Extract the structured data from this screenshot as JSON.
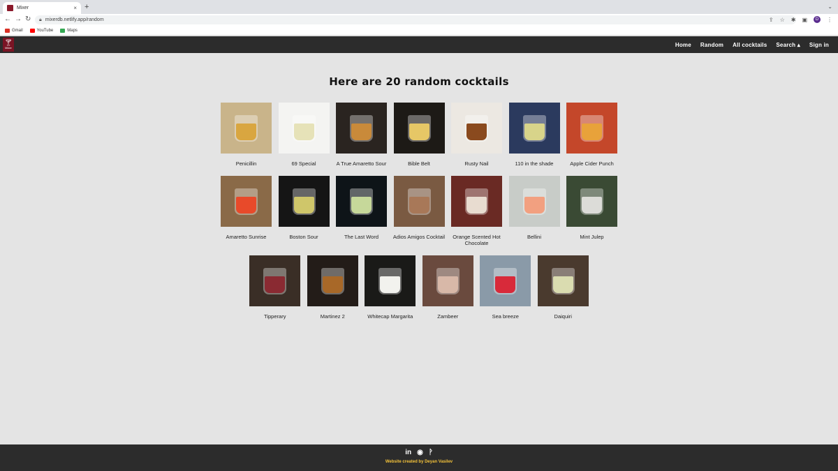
{
  "browser": {
    "tab_title": "Mixer",
    "tab_close": "×",
    "new_tab": "+",
    "url": "mixerdb.netlify.app/random",
    "avatar_letter": "D",
    "bookmarks": [
      {
        "label": "Gmail",
        "color": "#d93025"
      },
      {
        "label": "YouTube",
        "color": "#ff0000"
      },
      {
        "label": "Maps",
        "color": "#34a853"
      }
    ]
  },
  "nav": {
    "logo_word": "Mixer",
    "links": [
      "Home",
      "Random",
      "All cocktails",
      "Search ▴",
      "Sign in"
    ]
  },
  "main": {
    "heading": "Here are 20 random cocktails",
    "rows": [
      [
        {
          "name": "Penicillin",
          "bg": "#c9b48a",
          "drink": "#d9a640"
        },
        {
          "name": "69 Special",
          "bg": "#f4f4f2",
          "drink": "#e6e2b8"
        },
        {
          "name": "A True Amaretto Sour",
          "bg": "#2a2420",
          "drink": "#c98a3a"
        },
        {
          "name": "Bible Belt",
          "bg": "#1d1a16",
          "drink": "#e6c766"
        },
        {
          "name": "Rusty Nail",
          "bg": "#ece8e2",
          "drink": "#8a4a1e"
        },
        {
          "name": "110 in the shade",
          "bg": "#2b3a5e",
          "drink": "#d8d48a"
        },
        {
          "name": "Apple Cider Punch",
          "bg": "#c4472a",
          "drink": "#e8a23a"
        }
      ],
      [
        {
          "name": "Amaretto Sunrise",
          "bg": "#8a6a48",
          "drink": "#e84a2a"
        },
        {
          "name": "Boston Sour",
          "bg": "#151515",
          "drink": "#cfc66a"
        },
        {
          "name": "The Last Word",
          "bg": "#0e1418",
          "drink": "#c6d89a"
        },
        {
          "name": "Adios Amigos Cocktail",
          "bg": "#7a5a42",
          "drink": "#a87858"
        },
        {
          "name": "Orange Scented Hot Chocolate",
          "bg": "#6a2a24",
          "drink": "#e8dcd0"
        },
        {
          "name": "Bellini",
          "bg": "#c8ccc8",
          "drink": "#f2a080"
        },
        {
          "name": "Mint Julep",
          "bg": "#3a4a34",
          "drink": "#dcdcd8"
        }
      ],
      [
        {
          "name": "Tipperary",
          "bg": "#3a2e26",
          "drink": "#8a2a32"
        },
        {
          "name": "Martinez 2",
          "bg": "#231c18",
          "drink": "#a86828"
        },
        {
          "name": "Whitecap Margarita",
          "bg": "#1a1a18",
          "drink": "#f2f2ee"
        },
        {
          "name": "Zambeer",
          "bg": "#6a4a3e",
          "drink": "#d8b8a8"
        },
        {
          "name": "Sea breeze",
          "bg": "#8a9aa8",
          "drink": "#d82a3a"
        },
        {
          "name": "Daiquiri",
          "bg": "#4a3a2e",
          "drink": "#dadcb0"
        }
      ]
    ]
  },
  "footer": {
    "icons": [
      "in",
      "◉",
      "ᚹ"
    ],
    "credit": "Website created by Deyan Vasilev"
  }
}
